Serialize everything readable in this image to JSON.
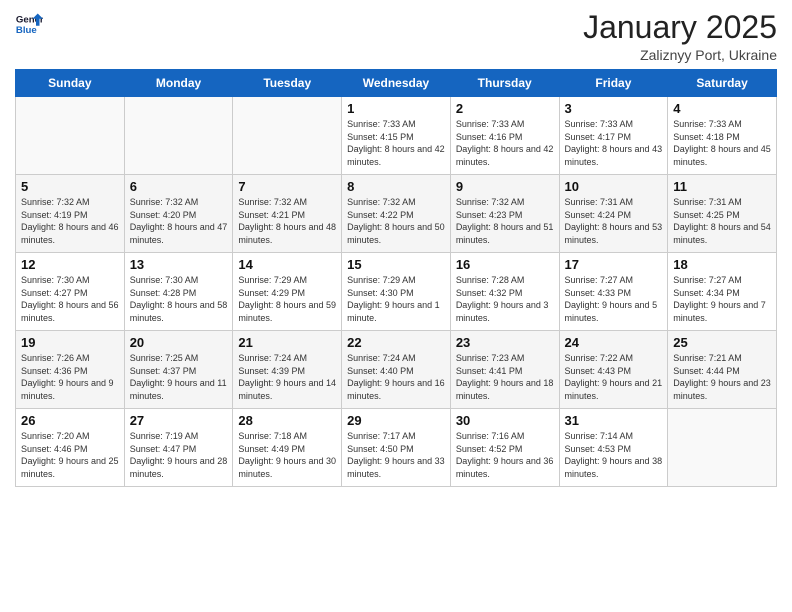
{
  "logo": {
    "line1": "General",
    "line2": "Blue"
  },
  "title": "January 2025",
  "subtitle": "Zaliznyy Port, Ukraine",
  "headers": [
    "Sunday",
    "Monday",
    "Tuesday",
    "Wednesday",
    "Thursday",
    "Friday",
    "Saturday"
  ],
  "weeks": [
    [
      {
        "day": "",
        "info": ""
      },
      {
        "day": "",
        "info": ""
      },
      {
        "day": "",
        "info": ""
      },
      {
        "day": "1",
        "info": "Sunrise: 7:33 AM\nSunset: 4:15 PM\nDaylight: 8 hours and 42 minutes."
      },
      {
        "day": "2",
        "info": "Sunrise: 7:33 AM\nSunset: 4:16 PM\nDaylight: 8 hours and 42 minutes."
      },
      {
        "day": "3",
        "info": "Sunrise: 7:33 AM\nSunset: 4:17 PM\nDaylight: 8 hours and 43 minutes."
      },
      {
        "day": "4",
        "info": "Sunrise: 7:33 AM\nSunset: 4:18 PM\nDaylight: 8 hours and 45 minutes."
      }
    ],
    [
      {
        "day": "5",
        "info": "Sunrise: 7:32 AM\nSunset: 4:19 PM\nDaylight: 8 hours and 46 minutes."
      },
      {
        "day": "6",
        "info": "Sunrise: 7:32 AM\nSunset: 4:20 PM\nDaylight: 8 hours and 47 minutes."
      },
      {
        "day": "7",
        "info": "Sunrise: 7:32 AM\nSunset: 4:21 PM\nDaylight: 8 hours and 48 minutes."
      },
      {
        "day": "8",
        "info": "Sunrise: 7:32 AM\nSunset: 4:22 PM\nDaylight: 8 hours and 50 minutes."
      },
      {
        "day": "9",
        "info": "Sunrise: 7:32 AM\nSunset: 4:23 PM\nDaylight: 8 hours and 51 minutes."
      },
      {
        "day": "10",
        "info": "Sunrise: 7:31 AM\nSunset: 4:24 PM\nDaylight: 8 hours and 53 minutes."
      },
      {
        "day": "11",
        "info": "Sunrise: 7:31 AM\nSunset: 4:25 PM\nDaylight: 8 hours and 54 minutes."
      }
    ],
    [
      {
        "day": "12",
        "info": "Sunrise: 7:30 AM\nSunset: 4:27 PM\nDaylight: 8 hours and 56 minutes."
      },
      {
        "day": "13",
        "info": "Sunrise: 7:30 AM\nSunset: 4:28 PM\nDaylight: 8 hours and 58 minutes."
      },
      {
        "day": "14",
        "info": "Sunrise: 7:29 AM\nSunset: 4:29 PM\nDaylight: 8 hours and 59 minutes."
      },
      {
        "day": "15",
        "info": "Sunrise: 7:29 AM\nSunset: 4:30 PM\nDaylight: 9 hours and 1 minute."
      },
      {
        "day": "16",
        "info": "Sunrise: 7:28 AM\nSunset: 4:32 PM\nDaylight: 9 hours and 3 minutes."
      },
      {
        "day": "17",
        "info": "Sunrise: 7:27 AM\nSunset: 4:33 PM\nDaylight: 9 hours and 5 minutes."
      },
      {
        "day": "18",
        "info": "Sunrise: 7:27 AM\nSunset: 4:34 PM\nDaylight: 9 hours and 7 minutes."
      }
    ],
    [
      {
        "day": "19",
        "info": "Sunrise: 7:26 AM\nSunset: 4:36 PM\nDaylight: 9 hours and 9 minutes."
      },
      {
        "day": "20",
        "info": "Sunrise: 7:25 AM\nSunset: 4:37 PM\nDaylight: 9 hours and 11 minutes."
      },
      {
        "day": "21",
        "info": "Sunrise: 7:24 AM\nSunset: 4:39 PM\nDaylight: 9 hours and 14 minutes."
      },
      {
        "day": "22",
        "info": "Sunrise: 7:24 AM\nSunset: 4:40 PM\nDaylight: 9 hours and 16 minutes."
      },
      {
        "day": "23",
        "info": "Sunrise: 7:23 AM\nSunset: 4:41 PM\nDaylight: 9 hours and 18 minutes."
      },
      {
        "day": "24",
        "info": "Sunrise: 7:22 AM\nSunset: 4:43 PM\nDaylight: 9 hours and 21 minutes."
      },
      {
        "day": "25",
        "info": "Sunrise: 7:21 AM\nSunset: 4:44 PM\nDaylight: 9 hours and 23 minutes."
      }
    ],
    [
      {
        "day": "26",
        "info": "Sunrise: 7:20 AM\nSunset: 4:46 PM\nDaylight: 9 hours and 25 minutes."
      },
      {
        "day": "27",
        "info": "Sunrise: 7:19 AM\nSunset: 4:47 PM\nDaylight: 9 hours and 28 minutes."
      },
      {
        "day": "28",
        "info": "Sunrise: 7:18 AM\nSunset: 4:49 PM\nDaylight: 9 hours and 30 minutes."
      },
      {
        "day": "29",
        "info": "Sunrise: 7:17 AM\nSunset: 4:50 PM\nDaylight: 9 hours and 33 minutes."
      },
      {
        "day": "30",
        "info": "Sunrise: 7:16 AM\nSunset: 4:52 PM\nDaylight: 9 hours and 36 minutes."
      },
      {
        "day": "31",
        "info": "Sunrise: 7:14 AM\nSunset: 4:53 PM\nDaylight: 9 hours and 38 minutes."
      },
      {
        "day": "",
        "info": ""
      }
    ]
  ]
}
